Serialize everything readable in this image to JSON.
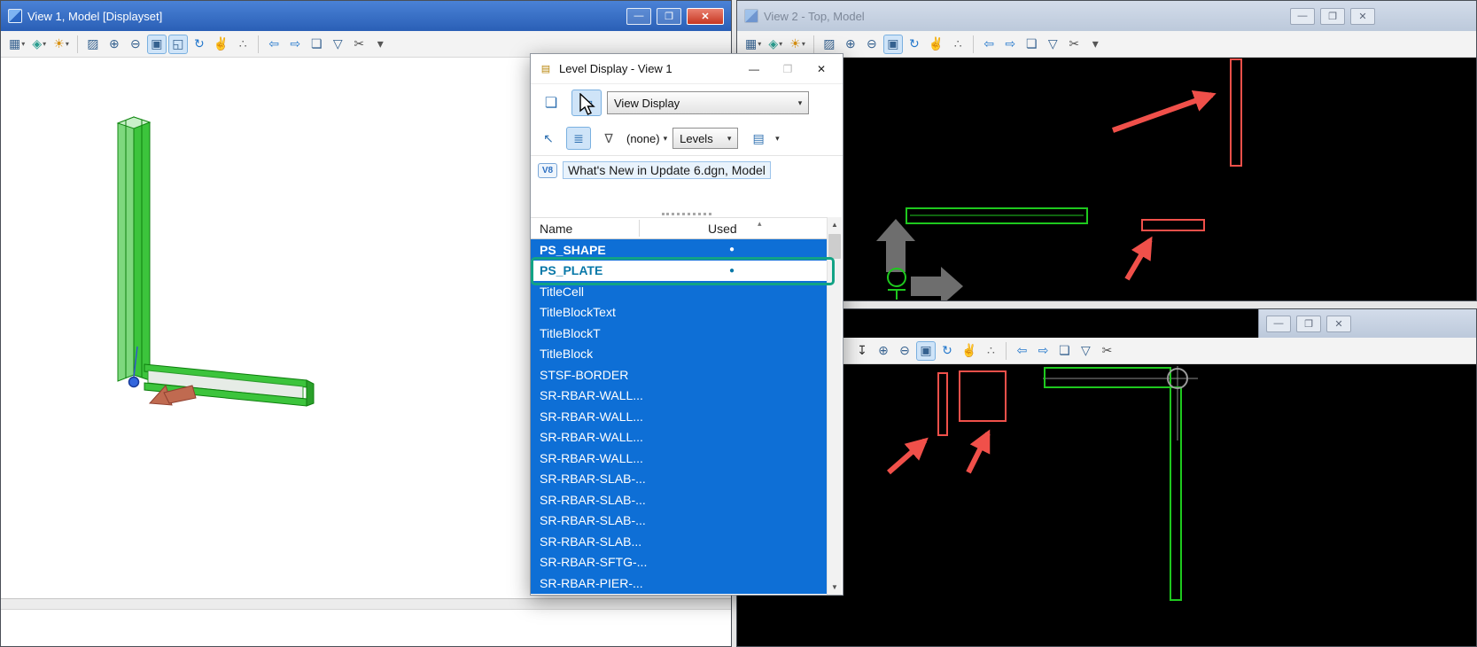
{
  "colors": {
    "active_titlebar": "#2e66bd",
    "inactive_titlebar": "#c3cfdf",
    "close_red": "#c63722",
    "selection_blue": "#0e6fd6",
    "highlight_teal": "#12a385",
    "canvas_green": "#1ec81e",
    "marker_red": "#f0504a"
  },
  "window_controls": {
    "minimize": "—",
    "maximize": "❐",
    "close": "✕"
  },
  "view1": {
    "title": "View 1, Model [Displayset]",
    "toolbar": [
      {
        "n": "view-attributes-icon",
        "g": "▦",
        "c": true
      },
      {
        "n": "display-style-icon",
        "g": "◈",
        "c": true,
        "col": "#2a9d8f"
      },
      {
        "n": "adjust-brightness-icon",
        "g": "☀",
        "c": true,
        "col": "#d89010"
      },
      {
        "s": true
      },
      {
        "n": "update-view-icon",
        "g": "▨"
      },
      {
        "n": "zoom-in-icon",
        "g": "⊕"
      },
      {
        "n": "zoom-out-icon",
        "g": "⊖"
      },
      {
        "n": "window-area-icon",
        "g": "▣",
        "p": true
      },
      {
        "n": "fit-view-icon",
        "g": "◱",
        "p": true
      },
      {
        "n": "rotate-view-icon",
        "g": "↻",
        "col": "#2277cc"
      },
      {
        "n": "pan-view-icon",
        "g": "✌"
      },
      {
        "n": "walk-icon",
        "g": "∴",
        "col": "#666666"
      },
      {
        "s": true
      },
      {
        "n": "view-previous-icon",
        "g": "⇦",
        "col": "#2277cc"
      },
      {
        "n": "view-next-icon",
        "g": "⇨",
        "col": "#2277cc"
      },
      {
        "n": "copy-view-icon",
        "g": "❏"
      },
      {
        "n": "clip-volume-icon",
        "g": "▽"
      },
      {
        "n": "clip-mask-icon",
        "g": "✂",
        "col": "#555555"
      },
      {
        "n": "clip-tools-dropdown-icon",
        "g": "▾",
        "col": "#555555"
      }
    ]
  },
  "view2": {
    "title": "View 2 - Top, Model",
    "toolbar": [
      {
        "n": "view-attributes-icon",
        "g": "▦",
        "c": true
      },
      {
        "n": "display-style-icon",
        "g": "◈",
        "c": true,
        "col": "#2a9d8f"
      },
      {
        "n": "adjust-brightness-icon",
        "g": "☀",
        "c": true,
        "col": "#d89010"
      },
      {
        "s": true
      },
      {
        "n": "update-view-icon",
        "g": "▨"
      },
      {
        "n": "zoom-in-icon",
        "g": "⊕"
      },
      {
        "n": "zoom-out-icon",
        "g": "⊖"
      },
      {
        "n": "window-area-icon",
        "g": "▣",
        "p": true
      },
      {
        "n": "rotate-view-icon",
        "g": "↻",
        "col": "#2277cc"
      },
      {
        "n": "pan-view-icon",
        "g": "✌"
      },
      {
        "n": "walk-icon",
        "g": "∴",
        "col": "#666666"
      },
      {
        "s": true
      },
      {
        "n": "view-previous-icon",
        "g": "⇦",
        "col": "#2277cc"
      },
      {
        "n": "view-next-icon",
        "g": "⇨",
        "col": "#2277cc"
      },
      {
        "n": "copy-view-icon",
        "g": "❏"
      },
      {
        "n": "clip-volume-icon",
        "g": "▽"
      },
      {
        "n": "clip-mask-icon",
        "g": "✂",
        "col": "#555555"
      },
      {
        "n": "clip-tools-dropdown-icon",
        "g": "▾",
        "col": "#555555"
      }
    ]
  },
  "view3": {
    "title": "",
    "toolbar": [
      {
        "n": "update-view-icon",
        "g": "↧",
        "col": "#333333"
      },
      {
        "n": "zoom-in-icon",
        "g": "⊕"
      },
      {
        "n": "zoom-out-icon",
        "g": "⊖"
      },
      {
        "n": "window-area-icon",
        "g": "▣",
        "p": true
      },
      {
        "n": "rotate-view-icon",
        "g": "↻",
        "col": "#2277cc"
      },
      {
        "n": "pan-view-icon",
        "g": "✌"
      },
      {
        "n": "walk-icon",
        "g": "∴",
        "col": "#666666"
      },
      {
        "s": true
      },
      {
        "n": "view-previous-icon",
        "g": "⇦",
        "col": "#2277cc"
      },
      {
        "n": "view-next-icon",
        "g": "⇨",
        "col": "#2277cc"
      },
      {
        "n": "copy-view-icon",
        "g": "❏"
      },
      {
        "n": "clip-volume-icon",
        "g": "▽"
      },
      {
        "n": "clip-mask-icon",
        "g": "✂",
        "col": "#555555"
      }
    ]
  },
  "dialog": {
    "title": "Level Display - View 1",
    "icon_glyph": "▤",
    "v8_label": "V8",
    "toolbar1": {
      "copy_levels_glyph": "❏",
      "apply_to_window_glyph": "▭",
      "view_display_value": "View Display",
      "combo_caret": "▾"
    },
    "toolbar2": {
      "change_level_glyph": "↖",
      "tree_display_glyph": "≣",
      "filter_glyph": "∇",
      "filter_value": "(none)",
      "filter_caret": "▾",
      "mode_value": "Levels",
      "mode_caret": "▾",
      "symbology_glyph": "▤",
      "symbology_caret": "▾"
    },
    "tree_item": "What's New in Update 6.dgn, Model",
    "columns": {
      "name": "Name",
      "used": "Used",
      "sort_glyph": "▴"
    },
    "scroll": {
      "up": "▲",
      "down": "▼"
    },
    "rows": [
      {
        "name": "PS_SHAPE",
        "used": "●",
        "state": "selected-bold"
      },
      {
        "name": "PS_PLATE",
        "used": "●",
        "state": "highlight"
      },
      {
        "name": "TitleCell",
        "used": "",
        "state": "selected"
      },
      {
        "name": "TitleBlockText",
        "used": "",
        "state": "selected"
      },
      {
        "name": "TitleBlockT",
        "used": "",
        "state": "selected"
      },
      {
        "name": "TitleBlock",
        "used": "",
        "state": "selected"
      },
      {
        "name": "STSF-BORDER",
        "used": "",
        "state": "selected"
      },
      {
        "name": "SR-RBAR-WALL...",
        "used": "",
        "state": "selected"
      },
      {
        "name": "SR-RBAR-WALL...",
        "used": "",
        "state": "selected"
      },
      {
        "name": "SR-RBAR-WALL...",
        "used": "",
        "state": "selected"
      },
      {
        "name": "SR-RBAR-WALL...",
        "used": "",
        "state": "selected"
      },
      {
        "name": "SR-RBAR-SLAB-...",
        "used": "",
        "state": "selected"
      },
      {
        "name": "SR-RBAR-SLAB-...",
        "used": "",
        "state": "selected"
      },
      {
        "name": "SR-RBAR-SLAB-...",
        "used": "",
        "state": "selected"
      },
      {
        "name": "SR-RBAR-SLAB...",
        "used": "",
        "state": "selected"
      },
      {
        "name": "SR-RBAR-SFTG-...",
        "used": "",
        "state": "selected"
      },
      {
        "name": "SR-RBAR-PIER-...",
        "used": "",
        "state": "selected"
      }
    ]
  }
}
